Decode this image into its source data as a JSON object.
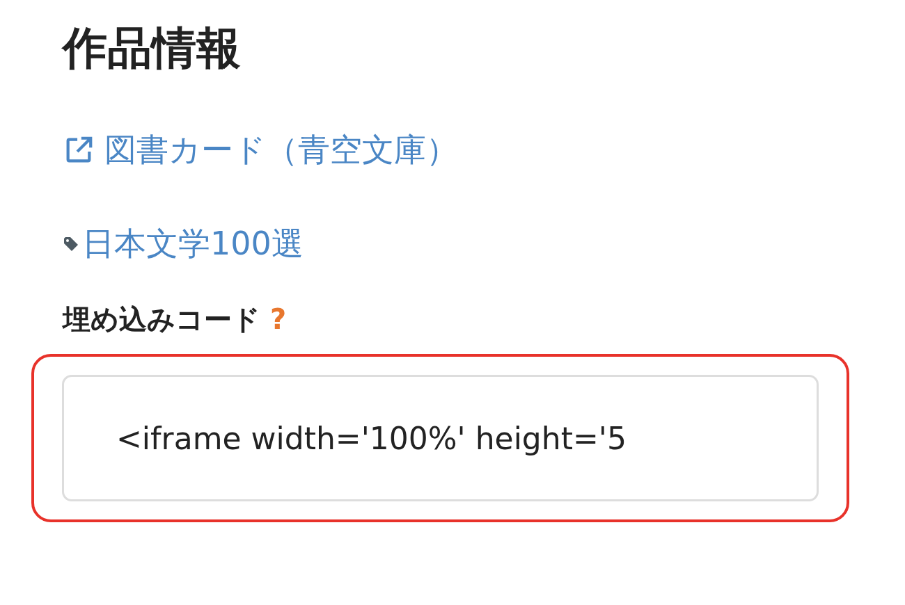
{
  "heading": "作品情報",
  "links": [
    {
      "kind": "external",
      "label": "図書カード（青空文庫）"
    },
    {
      "kind": "tag",
      "label": "日本文学100選"
    }
  ],
  "embed": {
    "label": "埋め込みコード",
    "help": "?",
    "value": "<iframe width='100%' height='5",
    "highlighted": true
  }
}
